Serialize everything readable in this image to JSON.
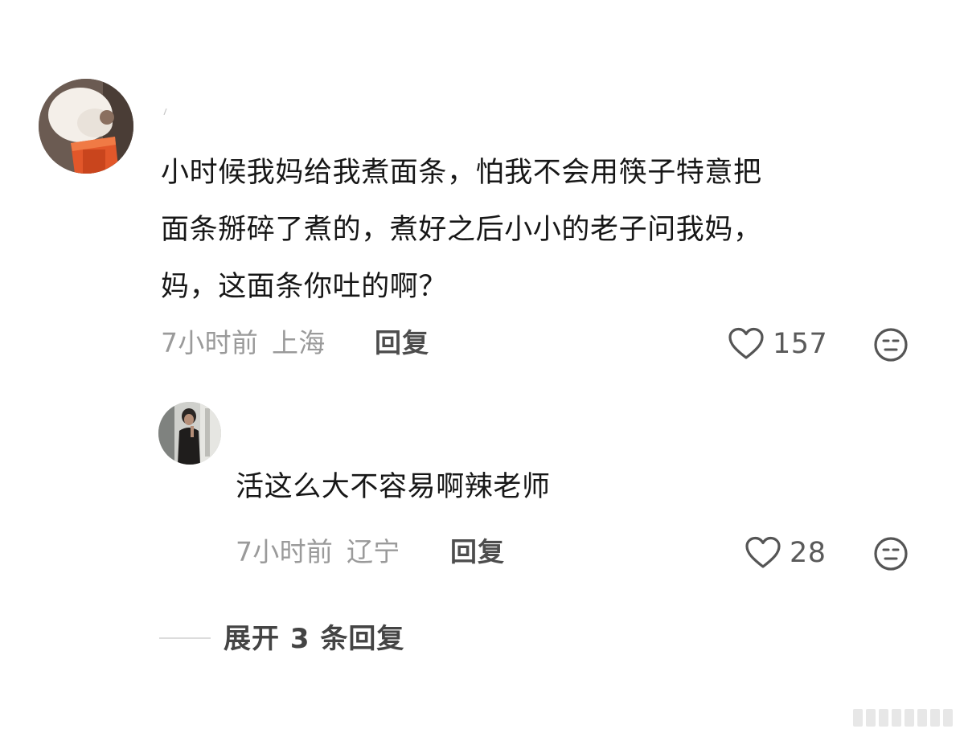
{
  "comment": {
    "text_line1": "小时候我妈给我煮面条，怕我不会用筷子特意把",
    "text_line2": "面条掰碎了煮的，煮好之后小小的老子问我妈，",
    "text_line3": "妈，这面条你吐的啊？",
    "time": "7小时前",
    "location": "上海",
    "reply_label": "回复",
    "like_count": "157"
  },
  "reply": {
    "text": "活这么大不容易啊辣老师",
    "time": "7小时前",
    "location": "辽宁",
    "reply_label": "回复",
    "like_count": "28"
  },
  "expand": {
    "label": "展开 3 条回复"
  },
  "icons": {
    "like": "heart-outline-icon",
    "dislike": "neutral-face-icon"
  },
  "colors": {
    "meta_gray": "#9a9a9a",
    "icon_gray": "#555555"
  }
}
